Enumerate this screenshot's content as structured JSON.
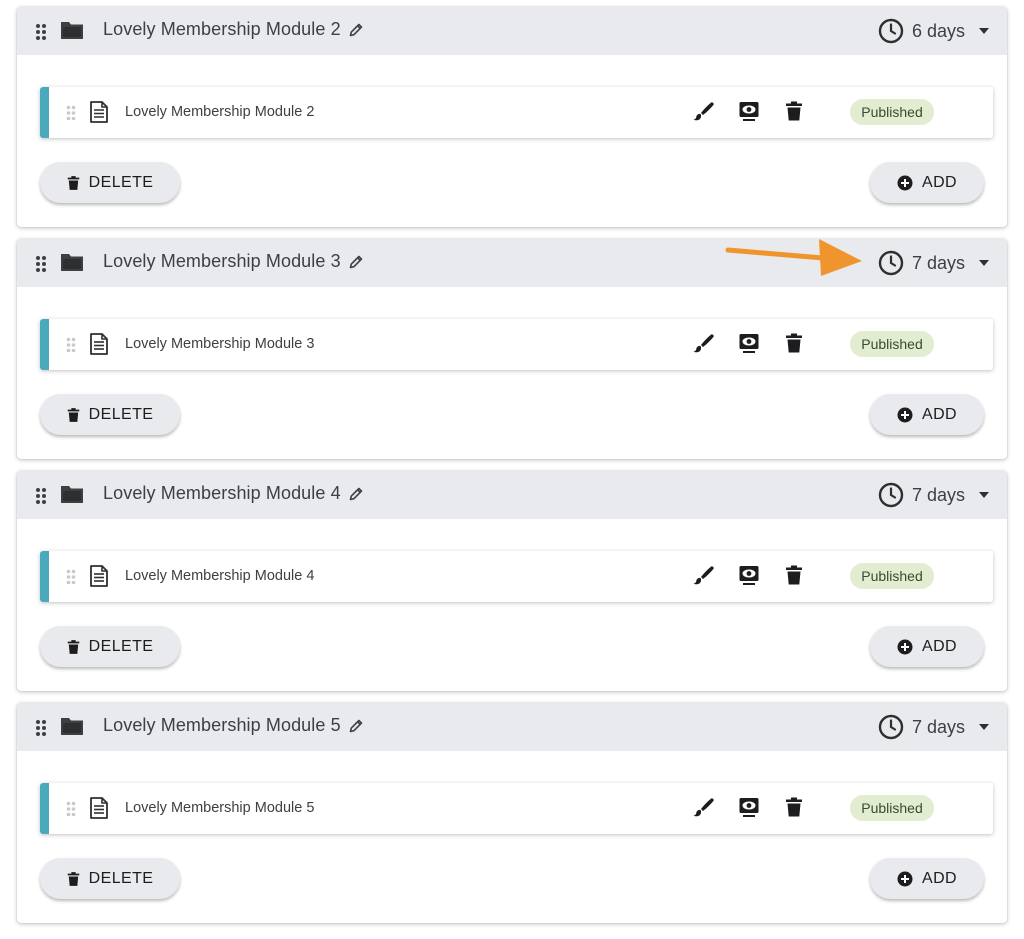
{
  "modules": [
    {
      "title": "Lovely Membership Module 2",
      "duration": "6 days",
      "lesson": {
        "title": "Lovely Membership Module 2",
        "status": "Published"
      },
      "delete_label": "DELETE",
      "add_label": "ADD"
    },
    {
      "title": "Lovely Membership Module 3",
      "duration": "7 days",
      "lesson": {
        "title": "Lovely Membership Module 3",
        "status": "Published"
      },
      "delete_label": "DELETE",
      "add_label": "ADD"
    },
    {
      "title": "Lovely Membership Module 4",
      "duration": "7 days",
      "lesson": {
        "title": "Lovely Membership Module 4",
        "status": "Published"
      },
      "delete_label": "DELETE",
      "add_label": "ADD"
    },
    {
      "title": "Lovely Membership Module 5",
      "duration": "7 days",
      "lesson": {
        "title": "Lovely Membership Module 5",
        "status": "Published"
      },
      "delete_label": "DELETE",
      "add_label": "ADD"
    }
  ],
  "icons": {
    "header": [
      "drag-handle-icon",
      "folder-icon",
      "pencil-icon",
      "clock-icon",
      "caret-down-icon"
    ],
    "lesson": [
      "drag-handle-icon",
      "document-icon",
      "brush-icon",
      "preview-icon",
      "trash-icon"
    ],
    "buttons": [
      "trash-icon",
      "add-circle-icon"
    ]
  },
  "colors": {
    "header_bg": "#e9eaed",
    "lesson_accent": "#4aa9bd",
    "published_badge_bg": "#e2ecd0",
    "annotation_arrow": "#f0952e"
  },
  "annotation": {
    "type": "arrow",
    "points_to": "modules.1.duration"
  }
}
